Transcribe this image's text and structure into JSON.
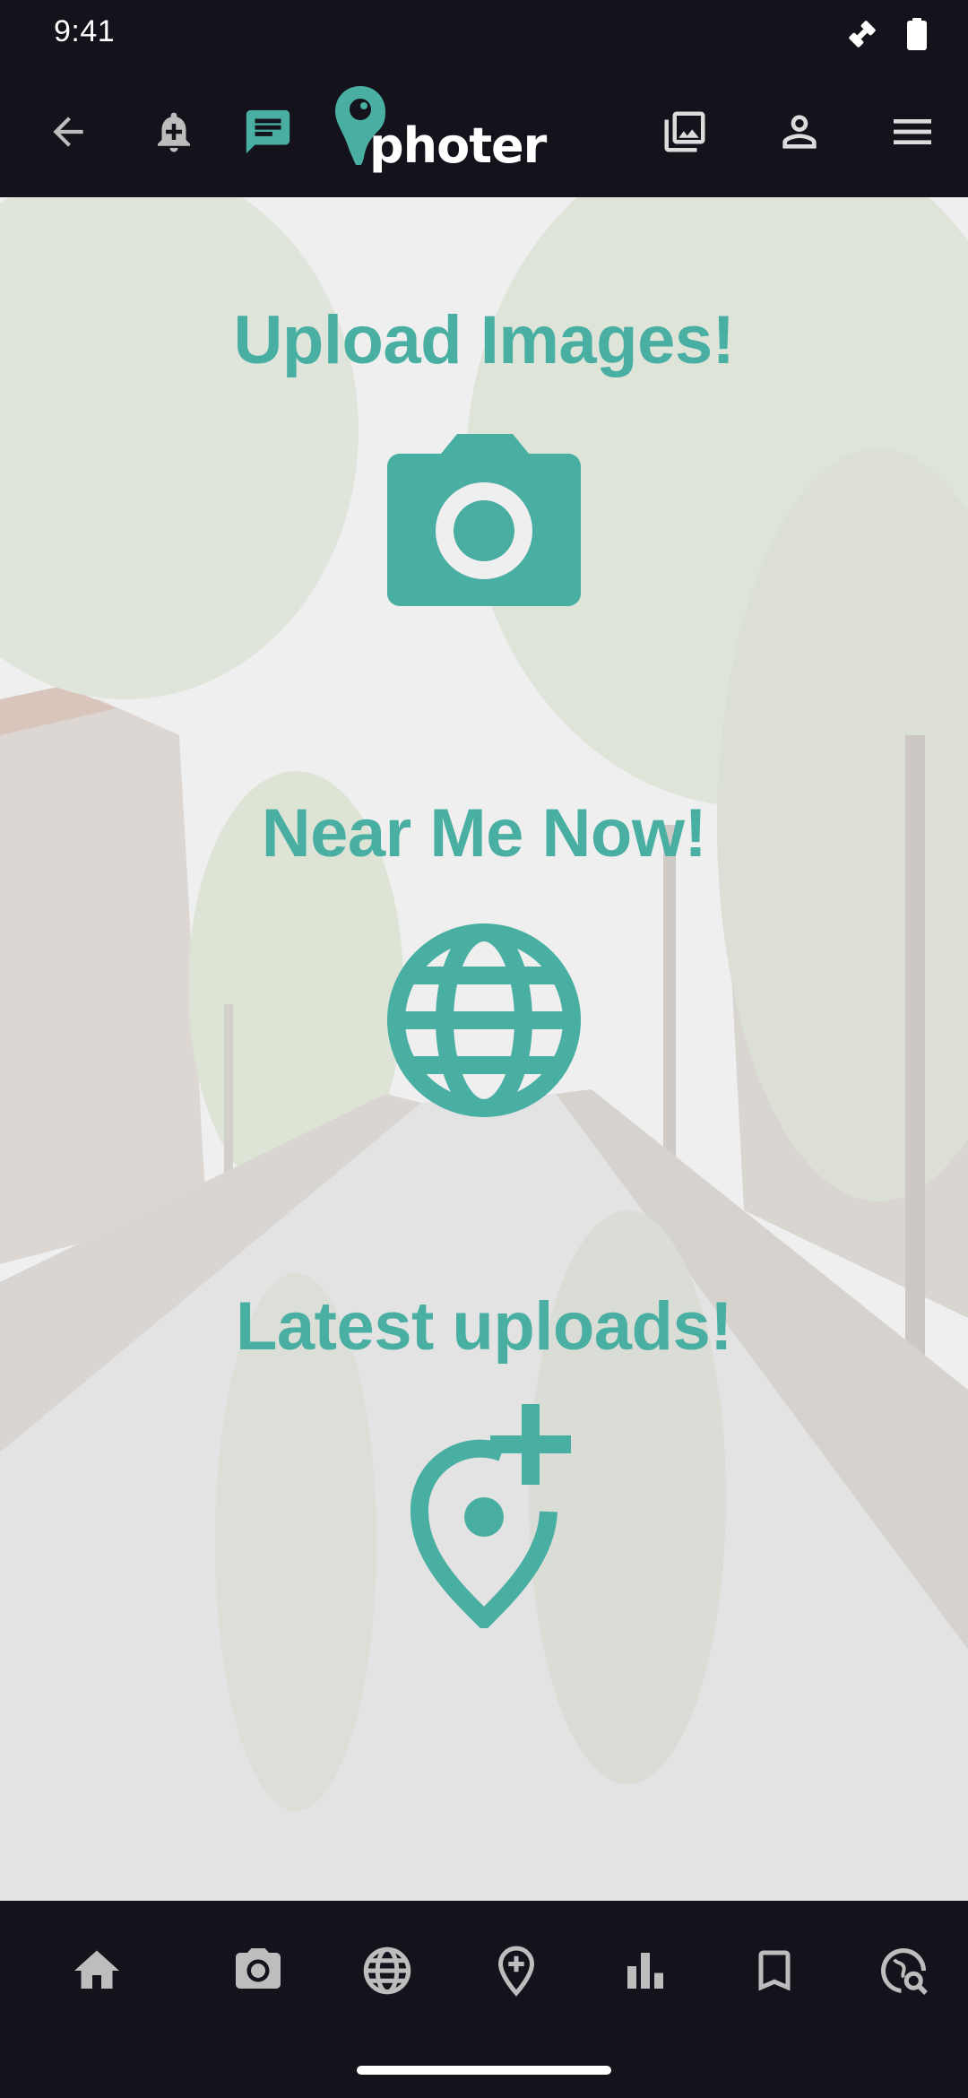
{
  "status_bar": {
    "time": "9:41"
  },
  "app": {
    "logo_text": "photer",
    "brand_color": "#4aafa3",
    "bar_color": "#14121a"
  },
  "header_icons": [
    "back-arrow-icon",
    "notification-add-icon",
    "chat-icon",
    "gallery-icon",
    "account-icon",
    "menu-icon"
  ],
  "sections": {
    "upload": {
      "title": "Upload Images!",
      "icon": "camera-icon"
    },
    "near_me": {
      "title": "Near Me Now!",
      "icon": "globe-icon"
    },
    "latest": {
      "title": "Latest uploads!",
      "icon": "add-location-icon"
    }
  },
  "bottom_nav": [
    "home-icon",
    "camera-icon",
    "globe-icon",
    "location-add-icon",
    "stats-icon",
    "bookmark-icon",
    "location-search-icon"
  ]
}
